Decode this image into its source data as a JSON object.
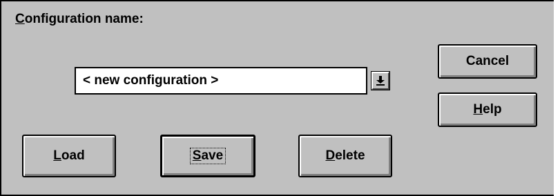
{
  "dialog": {
    "label": "Configuration name:",
    "label_mnemonic": "C",
    "label_rest": "onfiguration name:"
  },
  "combo": {
    "value": "< new configuration >",
    "dropdown_icon": "dropdown-arrow-icon"
  },
  "buttons": {
    "cancel": {
      "label": "Cancel"
    },
    "help": {
      "label": "Help",
      "mnemonic": "H",
      "rest": "elp"
    },
    "load": {
      "label": "Load",
      "mnemonic": "L",
      "rest": "oad"
    },
    "save": {
      "label": "Save",
      "mnemonic": "S",
      "rest": "ave"
    },
    "delete": {
      "label": "Delete",
      "mnemonic": "D",
      "rest": "elete"
    }
  },
  "colors": {
    "face": "#c0c0c0",
    "field": "#ffffff",
    "text": "#000000"
  }
}
